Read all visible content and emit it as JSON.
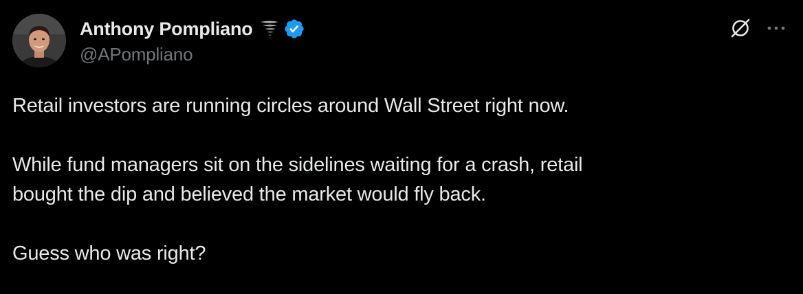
{
  "author": {
    "display_name": "Anthony Pompliano",
    "handle": "@APompliano",
    "emoji_icon": "tornado-icon",
    "verified_icon": "verified-badge-icon",
    "verified_color": "#1d9bf0"
  },
  "header_actions": {
    "grok_icon": "grok-icon",
    "more_icon": "more-dots-icon"
  },
  "tweet": {
    "paragraph_1": "Retail investors are running circles around Wall Street right now.",
    "paragraph_2_line_1": "While fund managers sit on the sidelines waiting for a crash, retail",
    "paragraph_2_line_2": "bought the dip and believed the market would fly back.",
    "paragraph_3": "Guess who was right?"
  },
  "colors": {
    "background": "#000000",
    "text_primary": "#e7e9ea",
    "text_secondary": "#71767b"
  }
}
